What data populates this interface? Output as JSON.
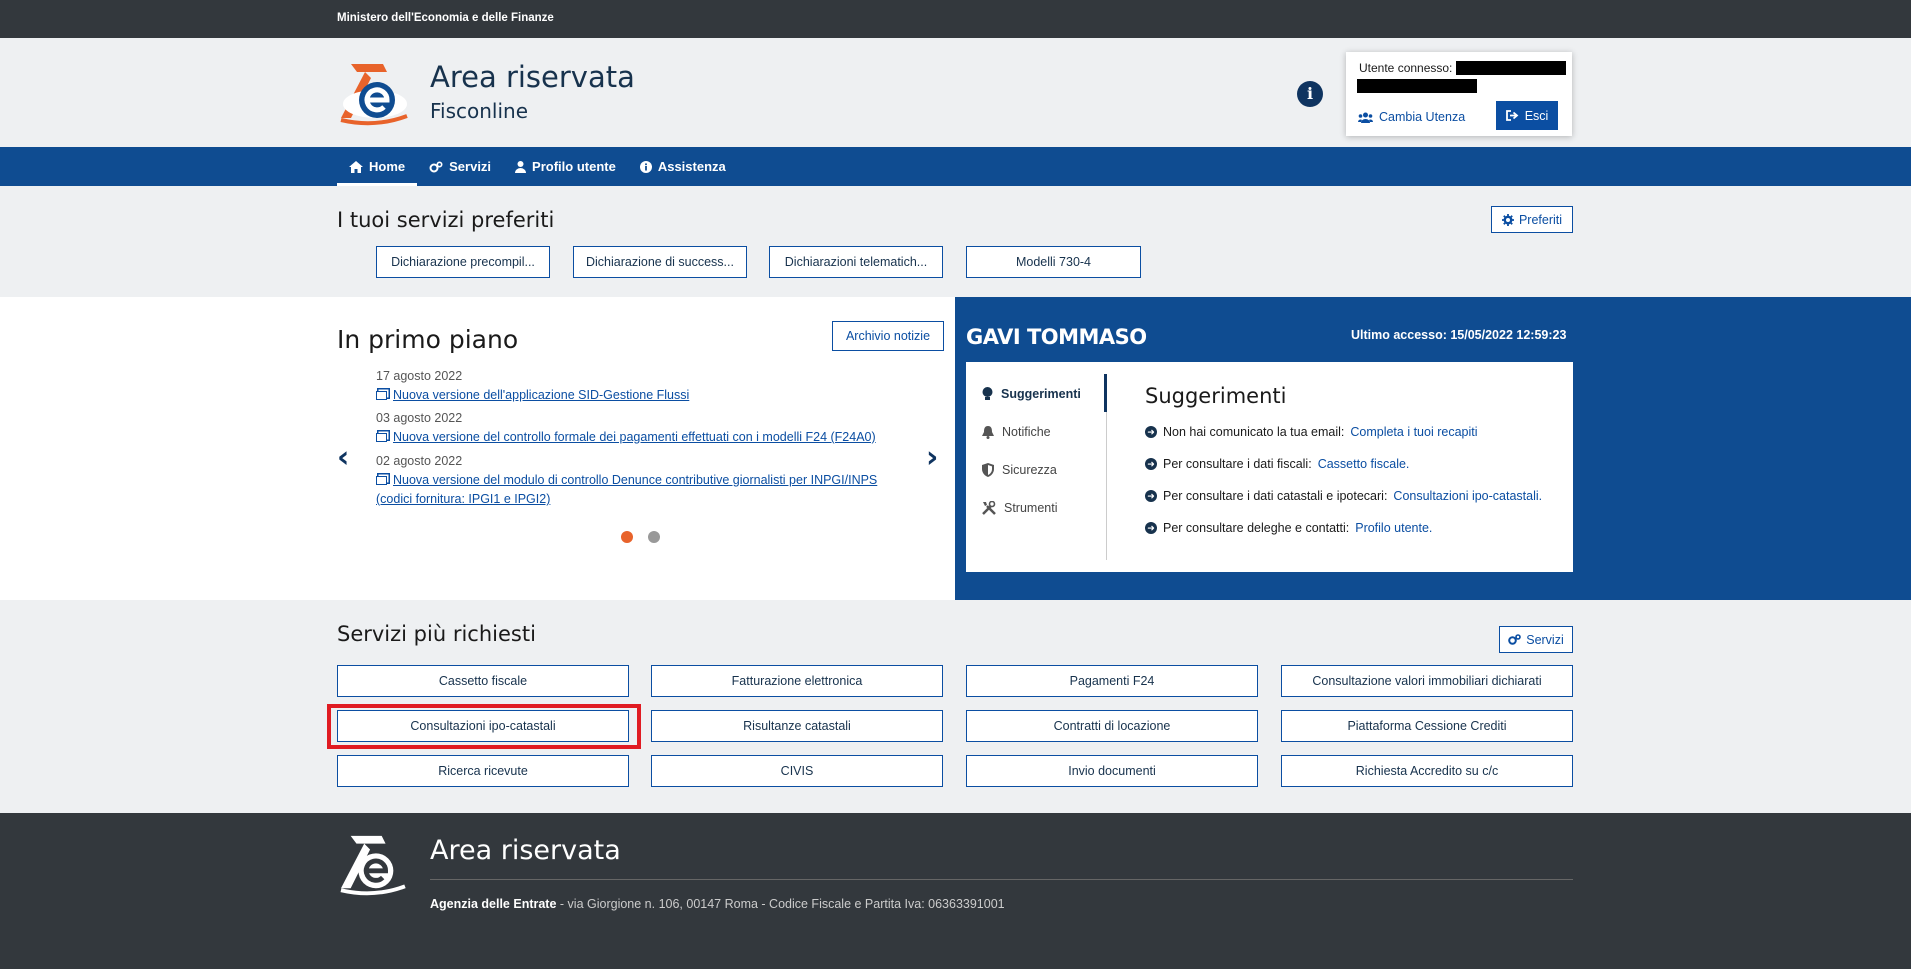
{
  "top_strip": {
    "ministry": "Ministero dell'Economia e delle Finanze"
  },
  "header": {
    "title": "Area riservata",
    "subtitle": "Fisconline",
    "info_icon": "i",
    "user": {
      "label": "Utente connesso:",
      "switch_label": "Cambia Utenza",
      "logout_label": "Esci"
    }
  },
  "nav": {
    "items": [
      {
        "label": "Home",
        "icon": "home-icon"
      },
      {
        "label": "Servizi",
        "icon": "cogs-icon"
      },
      {
        "label": "Profilo utente",
        "icon": "user-icon"
      },
      {
        "label": "Assistenza",
        "icon": "info-circle-icon"
      }
    ]
  },
  "favorites": {
    "title": "I tuoi servizi preferiti",
    "button": "Preferiti",
    "items": [
      "Dichiarazione precompil...",
      "Dichiarazione di success...",
      "Dichiarazioni telematich...",
      "Modelli 730-4"
    ]
  },
  "news": {
    "title": "In primo piano",
    "archive_button": "Archivio notizie",
    "items": [
      {
        "date": "17 agosto 2022",
        "text": "Nuova versione dell'applicazione SID-Gestione Flussi"
      },
      {
        "date": "03 agosto 2022",
        "text": "Nuova versione del controllo formale dei pagamenti effettuati con i modelli F24 (F24A0)"
      },
      {
        "date": "02 agosto 2022",
        "text": "Nuova versione del modulo di controllo Denunce contributive giornalisti per INPGI/INPS (codici fornitura: IPGI1 e IPGI2)"
      }
    ],
    "prev": "‹",
    "next": "›"
  },
  "user_panel": {
    "name": "GAVI TOMMASO",
    "last_access": "Ultimo accesso: 15/05/2022 12:59:23",
    "tabs": [
      "Suggerimenti",
      "Notifiche",
      "Sicurezza",
      "Strumenti"
    ],
    "suggestions_title": "Suggerimenti",
    "suggestions": [
      {
        "text": "Non hai comunicato la tua email: ",
        "link": "Completa i tuoi recapiti"
      },
      {
        "text": "Per consultare i dati fiscali: ",
        "link": "Cassetto fiscale."
      },
      {
        "text": "Per consultare i dati catastali e ipotecari: ",
        "link": "Consultazioni ipo-catastali."
      },
      {
        "text": "Per consultare deleghe e contatti: ",
        "link": "Profilo utente."
      }
    ]
  },
  "services": {
    "title": "Servizi più richiesti",
    "button": "Servizi",
    "items": [
      "Cassetto fiscale",
      "Fatturazione elettronica",
      "Pagamenti F24",
      "Consultazione valori immobiliari dichiarati",
      "Consultazioni ipo-catastali",
      "Risultanze catastali",
      "Contratti di locazione",
      "Piattaforma Cessione Crediti",
      "Ricerca ricevute",
      "CIVIS",
      "Invio documenti",
      "Richiesta Accredito su c/c"
    ]
  },
  "footer": {
    "title": "Area riservata",
    "agency": "Agenzia delle Entrate",
    "address": " - via Giorgione n. 106, 00147 Roma - Codice Fiscale e Partita Iva: 06363391001"
  }
}
